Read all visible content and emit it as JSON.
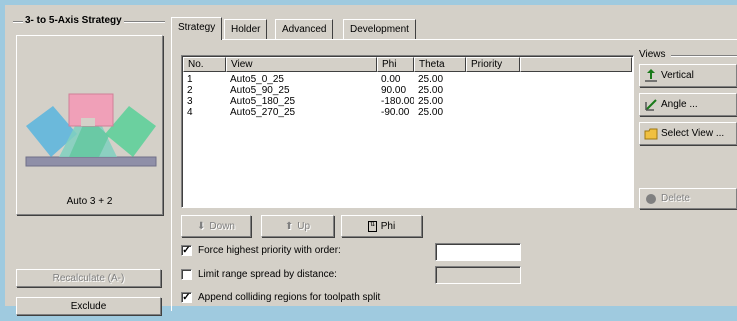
{
  "strategy_group": {
    "title": "3- to 5-Axis Strategy",
    "preview_label": "Auto 3 + 2",
    "recalculate_label": "Recalculate (A-)",
    "exclude_label": "Exclude"
  },
  "tabs": [
    {
      "label": "Strategy",
      "active": true
    },
    {
      "label": "Holder",
      "active": false
    },
    {
      "label": "Advanced",
      "active": false
    },
    {
      "label": "Development",
      "active": false
    }
  ],
  "table": {
    "columns": [
      "No.",
      "View",
      "Phi",
      "Theta",
      "Priority"
    ],
    "rows": [
      {
        "no": "1",
        "view": "Auto5_0_25",
        "phi": "0.00",
        "theta": "25.00",
        "priority": ""
      },
      {
        "no": "2",
        "view": "Auto5_90_25",
        "phi": "90.00",
        "theta": "25.00",
        "priority": ""
      },
      {
        "no": "3",
        "view": "Auto5_180_25",
        "phi": "-180.00",
        "theta": "25.00",
        "priority": ""
      },
      {
        "no": "4",
        "view": "Auto5_270_25",
        "phi": "-90.00",
        "theta": "25.00",
        "priority": ""
      }
    ]
  },
  "views": {
    "title": "Views",
    "vertical_label": "Vertical",
    "angle_label": "Angle ...",
    "select_view_label": "Select View ...",
    "delete_label": "Delete"
  },
  "order_buttons": {
    "down_label": "Down",
    "up_label": "Up",
    "phi_label": "Phi"
  },
  "options": {
    "force_priority_label": "Force highest priority with order:",
    "force_priority_checked": true,
    "force_priority_value": "",
    "limit_range_label": "Limit range spread by distance:",
    "limit_range_checked": false,
    "limit_range_value": "",
    "append_colliding_label": "Append colliding regions for toolpath split",
    "append_colliding_checked": true
  },
  "colors": {
    "background": "#9fcadf",
    "panel": "#d4d0c8"
  }
}
